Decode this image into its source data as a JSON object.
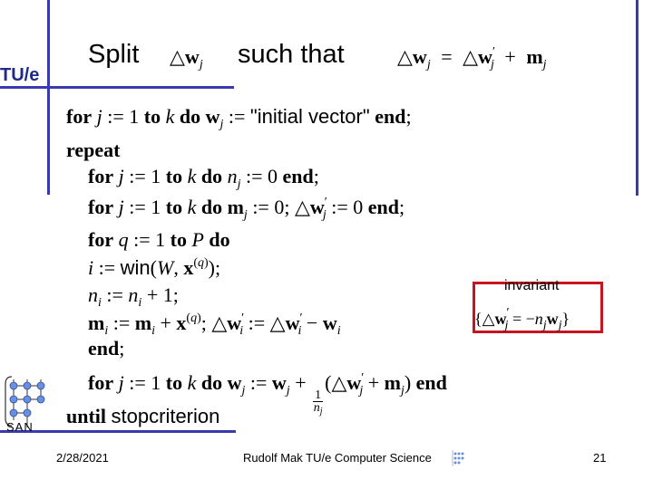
{
  "header": {
    "logo": "TU/e",
    "title_word1": "Split",
    "title_word2": "such that",
    "title_math1": "Δw_j",
    "title_math2_lhs": "Δw_j",
    "title_math2_eq": "=",
    "title_math2_rhs1": "Δw'_j",
    "title_math2_plus": "+",
    "title_math2_rhs2": "m_j"
  },
  "algorithm": {
    "kw_for": "for",
    "kw_to": "to",
    "kw_do": "do",
    "kw_end": "end",
    "kw_repeat": "repeat",
    "kw_until": "until",
    "initial_vector": "\"initial vector\"",
    "win": "win",
    "stopcriterion": "stopcriterion",
    "lines": [
      "for j := 1 to k do w_j := \"initial vector\" end;",
      "repeat",
      "for j := 1 to k do n_j := 0 end;",
      "for j := 1 to k do m_j := 0; Δw'_j := 0 end;",
      "for q := 1 to P do",
      "i := win(W, x^(q));",
      "n_i := n_i + 1;",
      "m_i := m_i + x^(q); Δw'_i := Δw'_i − w_i",
      "end;",
      "for j := 1 to k do w_j := w_j + 1/n_j (Δw'_j + m_j) end",
      "until stopcriterion"
    ]
  },
  "invariant": {
    "label": "invariant",
    "formula": "{Δw'_j = −n_j w_j}",
    "border_color": "#c8141e"
  },
  "logos": {
    "san": "SAN"
  },
  "footer": {
    "date": "2/28/2021",
    "author": "Rudolf Mak TU/e Computer Science",
    "page": "21"
  },
  "colors": {
    "accent_line": "#3a3ab0",
    "logo_text": "#1e2a8a"
  }
}
